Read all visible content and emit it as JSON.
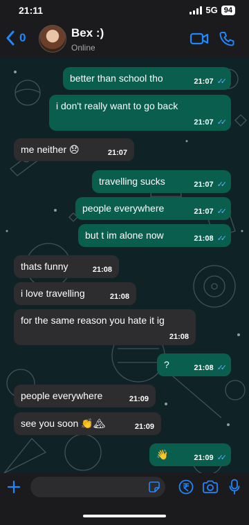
{
  "status": {
    "time": "21:11",
    "network": "5G",
    "battery": "94"
  },
  "header": {
    "back_count": "0",
    "contact_name": "Bex :)",
    "presence": "Online"
  },
  "messages": [
    {
      "text": "better than school tho",
      "time": "21:07",
      "dir": "out"
    },
    {
      "text": "i don't really want to go back",
      "time": "21:07",
      "dir": "out"
    },
    {
      "text": "me neither 😞",
      "time": "21:07",
      "dir": "in"
    },
    {
      "text": "travelling sucks",
      "time": "21:07",
      "dir": "out"
    },
    {
      "text": "people everywhere",
      "time": "21:07",
      "dir": "out"
    },
    {
      "text": "but t im alone now",
      "time": "21:08",
      "dir": "out"
    },
    {
      "text": "thats funny",
      "time": "21:08",
      "dir": "in"
    },
    {
      "text": "i love travelling",
      "time": "21:08",
      "dir": "in"
    },
    {
      "text": "for the same reason you hate it ig",
      "time": "21:08",
      "dir": "in"
    },
    {
      "text": "?",
      "time": "21:08",
      "dir": "out"
    },
    {
      "text": "people everywhere",
      "time": "21:09",
      "dir": "in"
    },
    {
      "text": "see you soon 👏🏔",
      "time": "21:09",
      "dir": "in"
    },
    {
      "text": "👋",
      "time": "21:09",
      "dir": "out"
    }
  ],
  "icons": {
    "back": "chevron-left-icon",
    "video": "video-camera-icon",
    "call": "phone-icon",
    "add": "plus-icon",
    "sticker": "sticker-icon",
    "payment": "rupee-icon",
    "camera": "camera-icon",
    "mic": "microphone-icon"
  },
  "colors": {
    "accent": "#1e88ff",
    "outgoing": "#0a5e4e",
    "incoming": "#2d2d30",
    "read_ticks": "#5fb0ff"
  }
}
